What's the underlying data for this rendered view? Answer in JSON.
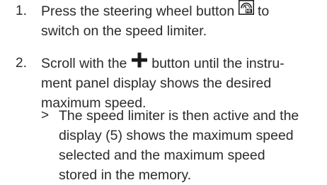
{
  "steps": [
    {
      "number": "1.",
      "lines": [
        {
          "before": "Press the steering wheel button ",
          "icon": "speed-limiter-steering-wheel-icon",
          "after": " to"
        },
        {
          "text": "switch on the speed limiter."
        }
      ]
    },
    {
      "number": "2.",
      "lines": [
        {
          "before": "Scroll with the ",
          "icon": "plus-icon",
          "after": " button until the instru-"
        },
        {
          "text": "ment panel display shows the desired"
        },
        {
          "text": "maximum speed."
        }
      ]
    }
  ],
  "result": {
    "marker": ">",
    "lines": [
      "The speed limiter is then active and the",
      "display (5) shows the maximum speed",
      "selected and the maximum speed",
      "stored in the memory."
    ]
  },
  "colors": {
    "text": "#2b2b2b",
    "icon": "#1a1a1a"
  }
}
